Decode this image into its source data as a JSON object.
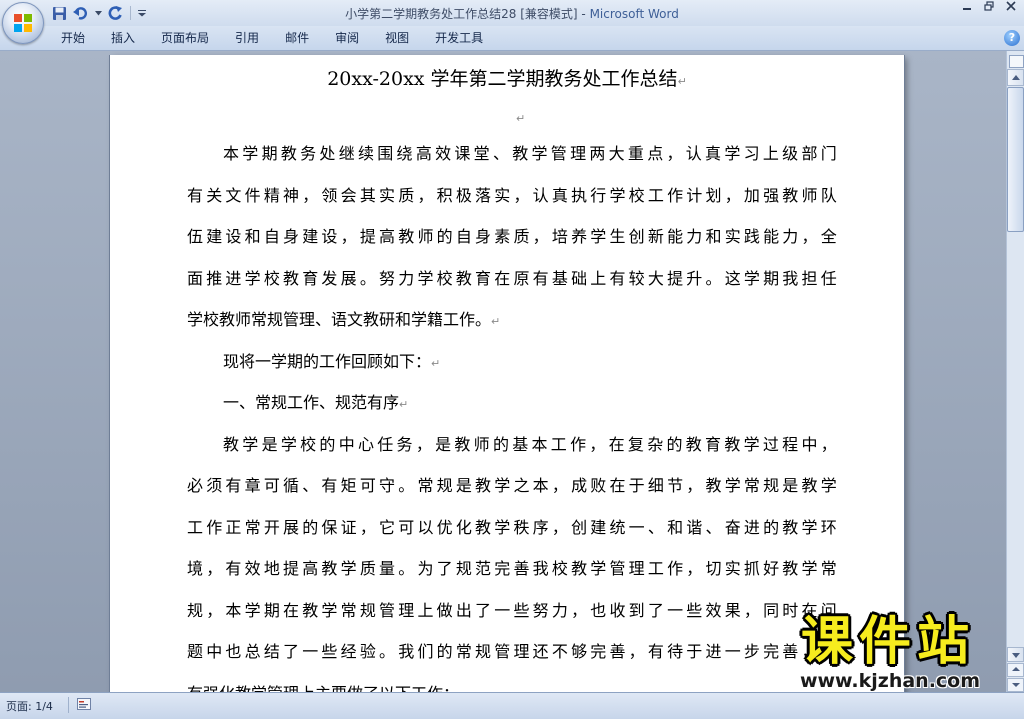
{
  "window": {
    "doc_name": "小学第二学期教务处工作总结28 [兼容模式]",
    "separator": " - ",
    "app_name": "Microsoft Word"
  },
  "ribbon": {
    "tabs": [
      {
        "label": "开始"
      },
      {
        "label": "插入"
      },
      {
        "label": "页面布局"
      },
      {
        "label": "引用"
      },
      {
        "label": "邮件"
      },
      {
        "label": "审阅"
      },
      {
        "label": "视图"
      },
      {
        "label": "开发工具"
      }
    ],
    "help_label": "?"
  },
  "document": {
    "title": "20xx-20xx 学年第二学期教务处工作总结",
    "paragraph_mark": "↵",
    "lines": [
      {
        "text": "本学期教务处继续围绕高效课堂、教学管理两大重点，认真学习上级部门",
        "indent": true,
        "justify": true,
        "mark": false
      },
      {
        "text": "有关文件精神，领会其实质，积极落实，认真执行学校工作计划，加强教师队",
        "indent": false,
        "justify": true,
        "mark": false
      },
      {
        "text": "伍建设和自身建设，提高教师的自身素质，培养学生创新能力和实践能力，全",
        "indent": false,
        "justify": true,
        "mark": false
      },
      {
        "text": "面推进学校教育发展。努力学校教育在原有基础上有较大提升。这学期我担任",
        "indent": false,
        "justify": true,
        "mark": false
      },
      {
        "text": "学校教师常规管理、语文教研和学籍工作。",
        "indent": false,
        "justify": false,
        "mark": true
      },
      {
        "text": "现将一学期的工作回顾如下：",
        "indent": true,
        "justify": false,
        "mark": true
      },
      {
        "text": "一、常规工作、规范有序",
        "indent": true,
        "justify": false,
        "mark": true
      },
      {
        "text": "教学是学校的中心任务，是教师的基本工作，在复杂的教育教学过程中，",
        "indent": true,
        "justify": true,
        "mark": false
      },
      {
        "text": "必须有章可循、有矩可守。常规是教学之本，成败在于细节，教学常规是教学",
        "indent": false,
        "justify": true,
        "mark": false
      },
      {
        "text": "工作正常开展的保证，它可以优化教学秩序，创建统一、和谐、奋进的教学环",
        "indent": false,
        "justify": true,
        "mark": false
      },
      {
        "text": "境，有效地提高教学质量。为了规范完善我校教学管理工作，切实抓好教学常",
        "indent": false,
        "justify": true,
        "mark": false
      },
      {
        "text": "规，本学期在教学常规管理上做出了一些努力，也收到了一些效果，同时在问",
        "indent": false,
        "justify": true,
        "mark": false
      },
      {
        "text": "题中也总结了一些经验。我们的常规管理还不够完善，有待于进一步完善，以",
        "indent": false,
        "justify": true,
        "mark": false
      },
      {
        "text": "有强化教学管理上主要做了以下工作：",
        "indent": false,
        "justify": false,
        "mark": false
      }
    ]
  },
  "status": {
    "page": "页面: 1/4"
  },
  "watermark": {
    "cn": "课件站",
    "url": "www.kjzhan.com"
  },
  "colors": {
    "accent": "#3e5f97",
    "watermark_yellow": "#f6ec1e"
  }
}
